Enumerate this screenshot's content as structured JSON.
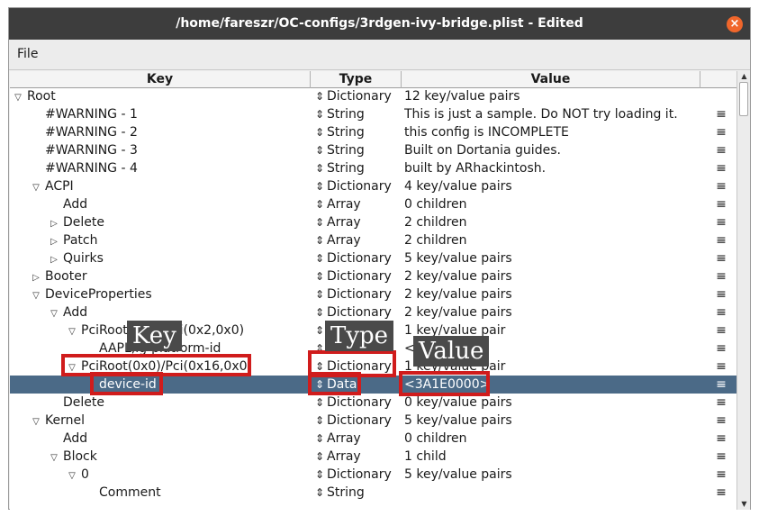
{
  "window": {
    "title": "/home/fareszr/OC-configs/3rdgen-ivy-bridge.plist - Edited",
    "close_glyph": "×"
  },
  "menu": {
    "file": "File"
  },
  "columns": {
    "key": "Key",
    "type": "Type",
    "value": "Value"
  },
  "rows": [
    {
      "key": "Root",
      "expander": "▽",
      "type": "Dictionary",
      "value": "12 key/value pairs",
      "menu": ""
    },
    {
      "key": "#WARNING - 1",
      "expander": "",
      "type": "String",
      "value": "This is just a sample. Do NOT try loading it.",
      "menu": "≡"
    },
    {
      "key": "#WARNING - 2",
      "expander": "",
      "type": "String",
      "value": "this config is INCOMPLETE",
      "menu": "≡"
    },
    {
      "key": "#WARNING - 3",
      "expander": "",
      "type": "String",
      "value": "Built on Dortania guides.",
      "menu": "≡"
    },
    {
      "key": "#WARNING - 4",
      "expander": "",
      "type": "String",
      "value": "built by ARhackintosh.",
      "menu": "≡"
    },
    {
      "key": "ACPI",
      "expander": "▽",
      "type": "Dictionary",
      "value": "4 key/value pairs",
      "menu": "≡"
    },
    {
      "key": "Add",
      "expander": "",
      "type": "Array",
      "value": "0 children",
      "menu": "≡"
    },
    {
      "key": "Delete",
      "expander": "▷",
      "type": "Array",
      "value": "2 children",
      "menu": "≡"
    },
    {
      "key": "Patch",
      "expander": "▷",
      "type": "Array",
      "value": "2 children",
      "menu": "≡"
    },
    {
      "key": "Quirks",
      "expander": "▷",
      "type": "Dictionary",
      "value": "5 key/value pairs",
      "menu": "≡"
    },
    {
      "key": "Booter",
      "expander": "▷",
      "type": "Dictionary",
      "value": "2 key/value pairs",
      "menu": "≡"
    },
    {
      "key": "DeviceProperties",
      "expander": "▽",
      "type": "Dictionary",
      "value": "2 key/value pairs",
      "menu": "≡"
    },
    {
      "key": "Add",
      "expander": "▽",
      "type": "Dictionary",
      "value": "2 key/value pairs",
      "menu": "≡"
    },
    {
      "key": "PciRoot(0x0)/Pci(0x2,0x0)",
      "expander": "▽",
      "type": "Dictionary",
      "value": "1 key/value pair",
      "menu": "≡"
    },
    {
      "key": "AAPL,ig-platform-id",
      "expander": "",
      "type": "Data",
      "value": "<01006201>",
      "menu": "≡"
    },
    {
      "key": "PciRoot(0x0)/Pci(0x16,0x0)",
      "expander": "▽",
      "type": "Dictionary",
      "value": "1 key/value pair",
      "menu": "≡"
    },
    {
      "key": "device-id",
      "expander": "",
      "type": "Data",
      "value": "<3A1E0000>",
      "menu": "≡",
      "selected": true
    },
    {
      "key": "Delete",
      "expander": "",
      "type": "Dictionary",
      "value": "0 key/value pairs",
      "menu": "≡"
    },
    {
      "key": "Kernel",
      "expander": "▽",
      "type": "Dictionary",
      "value": "5 key/value pairs",
      "menu": "≡"
    },
    {
      "key": "Add",
      "expander": "",
      "type": "Array",
      "value": "0 children",
      "menu": "≡"
    },
    {
      "key": "Block",
      "expander": "▽",
      "type": "Array",
      "value": "1 child",
      "menu": "≡"
    },
    {
      "key": "0",
      "expander": "▽",
      "type": "Dictionary",
      "value": "5 key/value pairs",
      "menu": "≡"
    },
    {
      "key": "Comment",
      "expander": "",
      "type": "String",
      "value": "",
      "menu": "≡"
    }
  ],
  "annotations": {
    "key": "Key",
    "type": "Type",
    "value": "Value"
  },
  "annotation_color": "#d01c1c",
  "selection_color": "#4b6a87"
}
